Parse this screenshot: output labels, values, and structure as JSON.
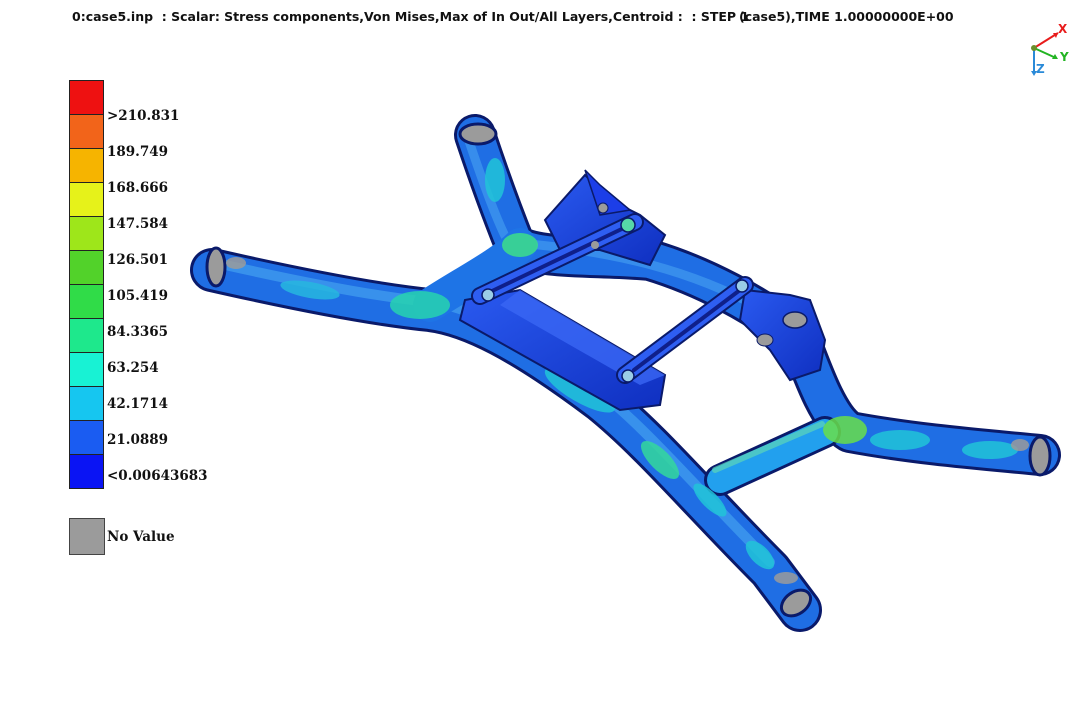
{
  "header": {
    "title": "0:case5.inp  : Scalar: Stress components,Von Mises,Max of In Out/All Layers,Centroid :  : STEP 1",
    "time": "(case5),TIME 1.00000000E+00"
  },
  "legend": {
    "colors": [
      "#ee1111",
      "#f2641a",
      "#f6b400",
      "#e6f21a",
      "#9ee61a",
      "#52d22a",
      "#30dc48",
      "#1ee88c",
      "#18f2d4",
      "#16c6f0",
      "#1a5cf2",
      "#0a14f4"
    ],
    "labels": [
      ">210.831",
      "189.749",
      "168.666",
      "147.584",
      "126.501",
      "105.419",
      "84.3365",
      "63.254",
      "42.1714",
      "21.0889",
      "<0.00643683"
    ],
    "no_value_label": "No Value",
    "no_value_color": "#9b9b9b"
  },
  "axes": {
    "x_label": "X",
    "y_label": "Y",
    "z_label": "Z",
    "x_color": "#e81c1c",
    "y_color": "#22b422",
    "z_color": "#2a8ad8"
  }
}
